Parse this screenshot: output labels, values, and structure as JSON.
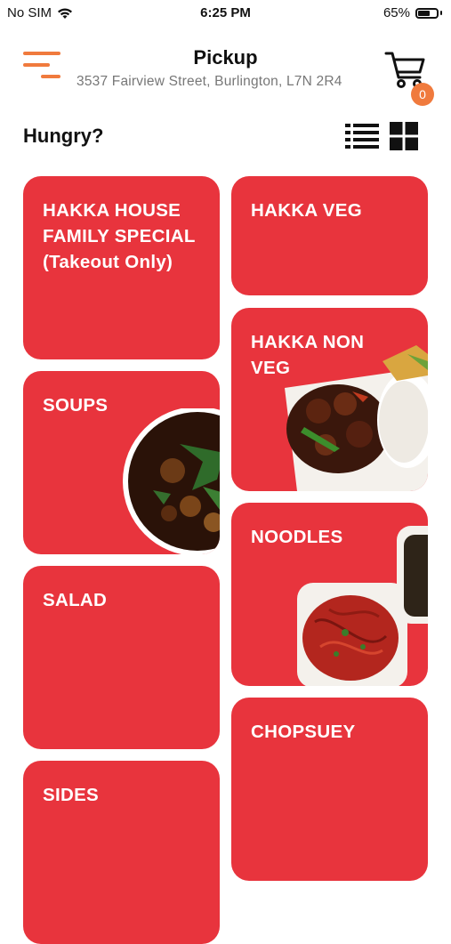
{
  "status_bar": {
    "carrier": "No SIM",
    "time": "6:25 PM",
    "battery": "65%"
  },
  "header": {
    "title": "Pickup",
    "address": "3537 Fairview Street, Burlington, L7N 2R4",
    "cart_count": "0"
  },
  "greeting": "Hungry?",
  "categories": [
    {
      "label": "HAKKA HOUSE\nFAMILY SPECIAL\n(Takeout Only)"
    },
    {
      "label": "HAKKA VEG"
    },
    {
      "label": "HAKKA NON\nVEG"
    },
    {
      "label": "SOUPS"
    },
    {
      "label": "NOODLES"
    },
    {
      "label": "SALAD"
    },
    {
      "label": "CHOPSUEY"
    },
    {
      "label": "SIDES"
    }
  ],
  "colors": {
    "accent": "#f07a3d",
    "tile": "#e8343d"
  }
}
